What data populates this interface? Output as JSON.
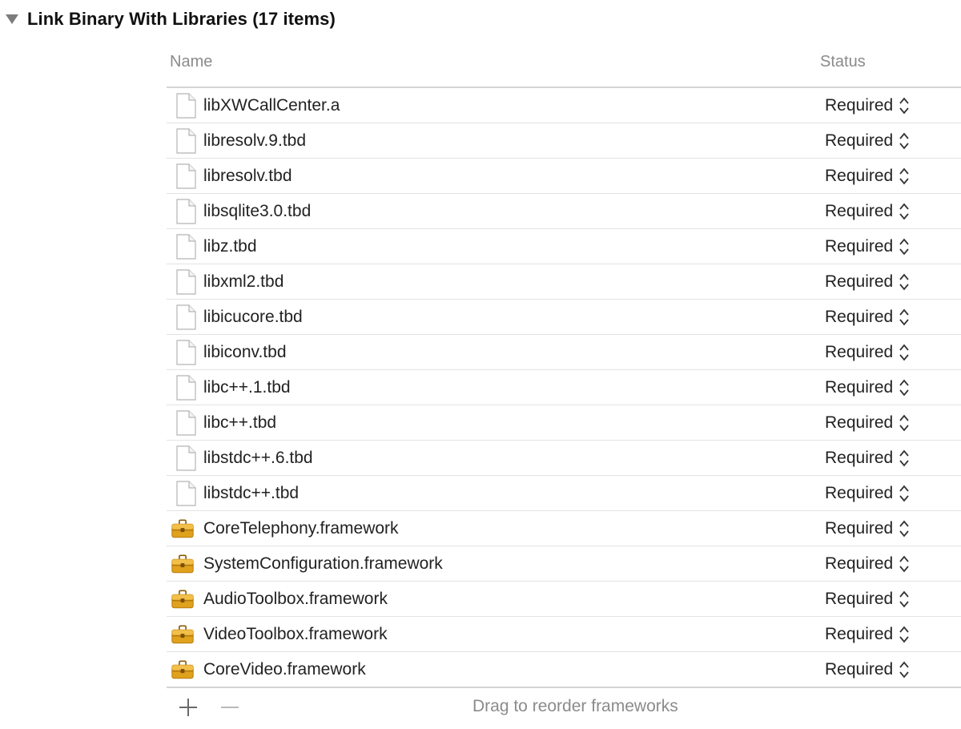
{
  "section": {
    "title": "Link Binary With Libraries (17 items)",
    "disclosure_icon": "triangle-down-icon"
  },
  "table": {
    "columns": {
      "name": "Name",
      "status": "Status"
    },
    "rows": [
      {
        "name": "libXWCallCenter.a",
        "icon": "file-icon",
        "status": "Required"
      },
      {
        "name": "libresolv.9.tbd",
        "icon": "file-icon",
        "status": "Required"
      },
      {
        "name": "libresolv.tbd",
        "icon": "file-icon",
        "status": "Required"
      },
      {
        "name": "libsqlite3.0.tbd",
        "icon": "file-icon",
        "status": "Required"
      },
      {
        "name": "libz.tbd",
        "icon": "file-icon",
        "status": "Required"
      },
      {
        "name": "libxml2.tbd",
        "icon": "file-icon",
        "status": "Required"
      },
      {
        "name": "libicucore.tbd",
        "icon": "file-icon",
        "status": "Required"
      },
      {
        "name": "libiconv.tbd",
        "icon": "file-icon",
        "status": "Required"
      },
      {
        "name": "libc++.1.tbd",
        "icon": "file-icon",
        "status": "Required"
      },
      {
        "name": "libc++.tbd",
        "icon": "file-icon",
        "status": "Required"
      },
      {
        "name": "libstdc++.6.tbd",
        "icon": "file-icon",
        "status": "Required"
      },
      {
        "name": "libstdc++.tbd",
        "icon": "file-icon",
        "status": "Required"
      },
      {
        "name": "CoreTelephony.framework",
        "icon": "toolbox-icon",
        "status": "Required"
      },
      {
        "name": "SystemConfiguration.framework",
        "icon": "toolbox-icon",
        "status": "Required"
      },
      {
        "name": "AudioToolbox.framework",
        "icon": "toolbox-icon",
        "status": "Required"
      },
      {
        "name": "VideoToolbox.framework",
        "icon": "toolbox-icon",
        "status": "Required"
      },
      {
        "name": "CoreVideo.framework",
        "icon": "toolbox-icon",
        "status": "Required"
      }
    ]
  },
  "footer": {
    "add_icon": "plus-icon",
    "remove_icon": "minus-icon",
    "hint": "Drag to reorder frameworks"
  },
  "colors": {
    "header_text": "#8b8b8b",
    "toolbox_body": "#e0a21c",
    "toolbox_dark": "#b57a0c",
    "divider": "#d4d4d4"
  }
}
